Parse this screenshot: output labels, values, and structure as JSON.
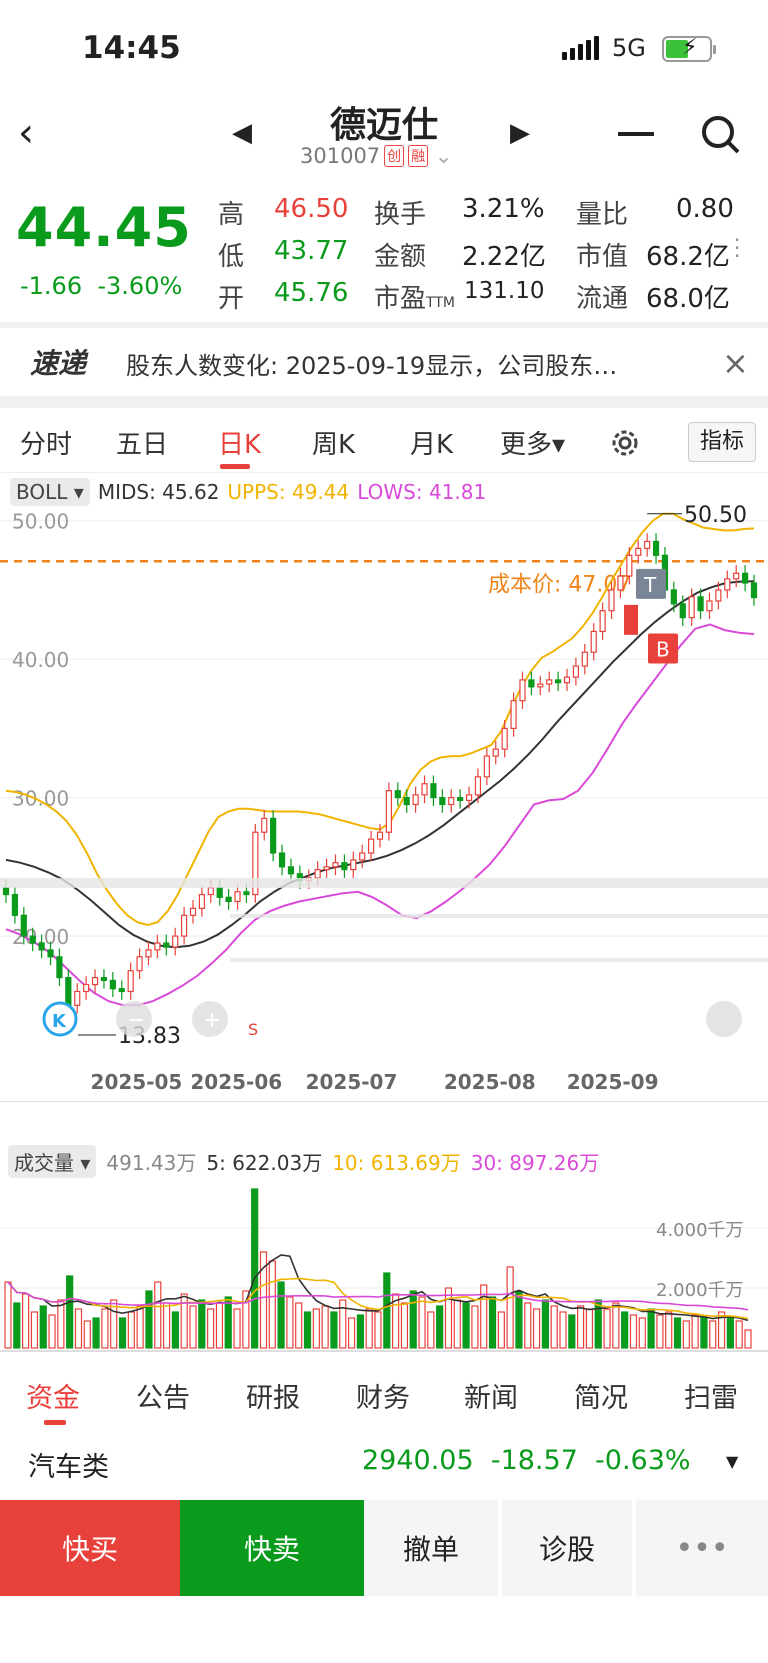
{
  "status_bar": {
    "time": "14:45",
    "network": "5G"
  },
  "header": {
    "title": "德迈仕",
    "code": "301007",
    "tag1": "创",
    "tag2": "融"
  },
  "quote": {
    "price": "44.45",
    "change": "-1.66",
    "change_pct": "-3.60%",
    "high_label": "高",
    "high": "46.50",
    "low_label": "低",
    "low": "43.77",
    "open_label": "开",
    "open": "45.76",
    "turnover_label": "换手",
    "turnover": "3.21%",
    "amount_label": "金额",
    "amount": "2.22亿",
    "pe_label": "市盈",
    "pe_sub": "TTM",
    "pe": "131.10",
    "vol_ratio_label": "量比",
    "vol_ratio": "0.80",
    "mcap_label": "市值",
    "mcap": "68.2亿",
    "float_label": "流通",
    "float": "68.0亿"
  },
  "notice": {
    "brand": "速递",
    "text": "股东人数变化: 2025-09-19显示，公司股东…"
  },
  "chart_tabs": [
    "分时",
    "五日",
    "日K",
    "周K",
    "月K",
    "更多▾"
  ],
  "chart_tab_active": "日K",
  "indicator_button": "指标",
  "boll": {
    "name": "BOLL",
    "mids": "MIDS: 45.62",
    "upps": "UPPS: 49.44",
    "lows": "LOWS: 41.81"
  },
  "cost_label": "成本价: 47.07",
  "markers": {
    "high": "50.50",
    "low": "13.83",
    "t": "T",
    "b": "B",
    "s": "S",
    "k": "K"
  },
  "volume_legend": {
    "name": "成交量",
    "vol": "491.43万",
    "ma5": "5: 622.03万",
    "ma10": "10: 613.69万",
    "ma30": "30: 897.26万"
  },
  "volume_axis": [
    "4.000千万",
    "2.000千万"
  ],
  "bottom_tabs": [
    "资金",
    "公告",
    "研报",
    "财务",
    "新闻",
    "简况",
    "扫雷"
  ],
  "bottom_tab_active": "资金",
  "sector": {
    "name": "汽车类",
    "value": "2940.05",
    "change": "-18.57",
    "pct": "-0.63%"
  },
  "actions": {
    "buy": "快买",
    "sell": "快卖",
    "cancel": "撤单",
    "diagnose": "诊股",
    "more": "•••"
  },
  "colors": {
    "up": "#e8413b",
    "down": "#0a9a1c",
    "upper": "#f0b400",
    "mid": "#333333",
    "lower": "#d94ad9",
    "cost": "#f0841c"
  },
  "chart_data": {
    "type": "candlestick",
    "x_ticks": [
      "2025-05",
      "2025-06",
      "2025-07",
      "2025-08",
      "2025-09"
    ],
    "y_ticks": [
      50,
      40,
      30,
      20
    ],
    "y_tick_labels": [
      "50.00",
      "40.00",
      "30.00",
      "20.00"
    ],
    "ylim": [
      13,
      52
    ],
    "cost": 47.07,
    "close": [
      23,
      21.5,
      20,
      19.5,
      19,
      18.5,
      17,
      15,
      16,
      16.5,
      17,
      16.8,
      16.2,
      16,
      17.5,
      18.5,
      19,
      19.5,
      19.2,
      20,
      21.5,
      22,
      23,
      23.5,
      22.8,
      22.5,
      23.2,
      23,
      27.5,
      28.5,
      26,
      25,
      24.5,
      24,
      24.2,
      24.8,
      25,
      25.3,
      24.8,
      25.5,
      26,
      27,
      27.5,
      30.5,
      30,
      29.5,
      30.2,
      31,
      30,
      29.5,
      30,
      29.8,
      30.2,
      31.5,
      33,
      33.5,
      35,
      37,
      38.5,
      38,
      38.2,
      38.5,
      38.3,
      38.7,
      39.5,
      40.5,
      42,
      43.5,
      45,
      46,
      47.5,
      48,
      48.5,
      47.5,
      45,
      44,
      43,
      44.5,
      43.5,
      44.2,
      45,
      45.8,
      46.2,
      45.5,
      44.45
    ],
    "upper": [
      30.5,
      30.4,
      30.2,
      29.9,
      29.5,
      29,
      28.3,
      27.3,
      26,
      24.5,
      23.3,
      22.3,
      21.5,
      21,
      20.8,
      21,
      21.8,
      23,
      24.5,
      26,
      27.5,
      28.6,
      29,
      29.2,
      29.2,
      29.1,
      29,
      29,
      29,
      29,
      28.9,
      28.8,
      28.6,
      28.4,
      28.2,
      28,
      27.8,
      27.7,
      28.2,
      29.5,
      31,
      32,
      32.6,
      32.9,
      33,
      33,
      33.2,
      33.5,
      33.8,
      34.8,
      36.5,
      38,
      39.2,
      40.1,
      40.5,
      41,
      41.5,
      42.3,
      43.3,
      44.5,
      45.8,
      47,
      48.2,
      49.2,
      50,
      50.5,
      50.5,
      50.1,
      49.8,
      49.5,
      49.4,
      49.3,
      49.3,
      49.4,
      49.44
    ],
    "mid": [
      25.5,
      25.3,
      25,
      24.6,
      24.1,
      23.4,
      22.6,
      21.7,
      20.8,
      20.1,
      19.6,
      19.3,
      19.2,
      19.3,
      19.6,
      20.1,
      20.8,
      21.6,
      22.5,
      23.2,
      23.8,
      24.2,
      24.6,
      24.9,
      25.1,
      25.3,
      25.5,
      25.8,
      26.2,
      26.7,
      27.3,
      28,
      28.8,
      29.6,
      30.4,
      31.2,
      32.1,
      33.1,
      34.2,
      35.4,
      36.5,
      37.6,
      38.7,
      39.8,
      40.8,
      41.8,
      42.7,
      43.5,
      44.2,
      44.8,
      45.2,
      45.5,
      45.6,
      45.62
    ],
    "lower": [
      20.5,
      20.1,
      19.5,
      18.8,
      17.8,
      16.8,
      15.9,
      15.3,
      15,
      15,
      15.3,
      15.8,
      16.4,
      17.1,
      18,
      19,
      20.2,
      21.2,
      21.8,
      22.2,
      22.5,
      22.7,
      22.9,
      23.1,
      23.2,
      22.8,
      22.2,
      21.5,
      21.3,
      21.8,
      22.5,
      23.3,
      24.2,
      25.2,
      26.5,
      28,
      29.5,
      29.8,
      29.9,
      30.5,
      31.8,
      33.5,
      35.3,
      36.8,
      38.2,
      39.6,
      41,
      42.2,
      42.5,
      42.1,
      41.9,
      41.81
    ],
    "volume": [
      2.2,
      1.5,
      1.8,
      1.2,
      1.4,
      1.1,
      1.6,
      2.4,
      1.3,
      0.9,
      1.0,
      1.3,
      1.6,
      1.0,
      1.2,
      1.4,
      1.9,
      2.2,
      1.5,
      1.2,
      1.8,
      1.4,
      1.6,
      1.3,
      1.5,
      1.7,
      1.3,
      1.9,
      5.3,
      3.2,
      2.9,
      2.2,
      1.7,
      1.5,
      1.2,
      1.3,
      1.4,
      1.2,
      1.6,
      1.0,
      1.1,
      1.3,
      1.2,
      2.5,
      1.8,
      1.5,
      1.9,
      1.7,
      1.2,
      1.4,
      2.0,
      1.6,
      1.5,
      1.4,
      2.1,
      1.7,
      1.2,
      2.7,
      1.9,
      1.5,
      1.3,
      1.6,
      1.4,
      1.2,
      1.1,
      1.4,
      1.3,
      1.6,
      1.3,
      1.5,
      1.2,
      1.1,
      1.0,
      1.3,
      1.1,
      1.2,
      1.0,
      0.9,
      1.1,
      1.0,
      0.9,
      1.2,
      1.0,
      0.9,
      0.6
    ],
    "volume_ylim": [
      0,
      5.6
    ]
  }
}
